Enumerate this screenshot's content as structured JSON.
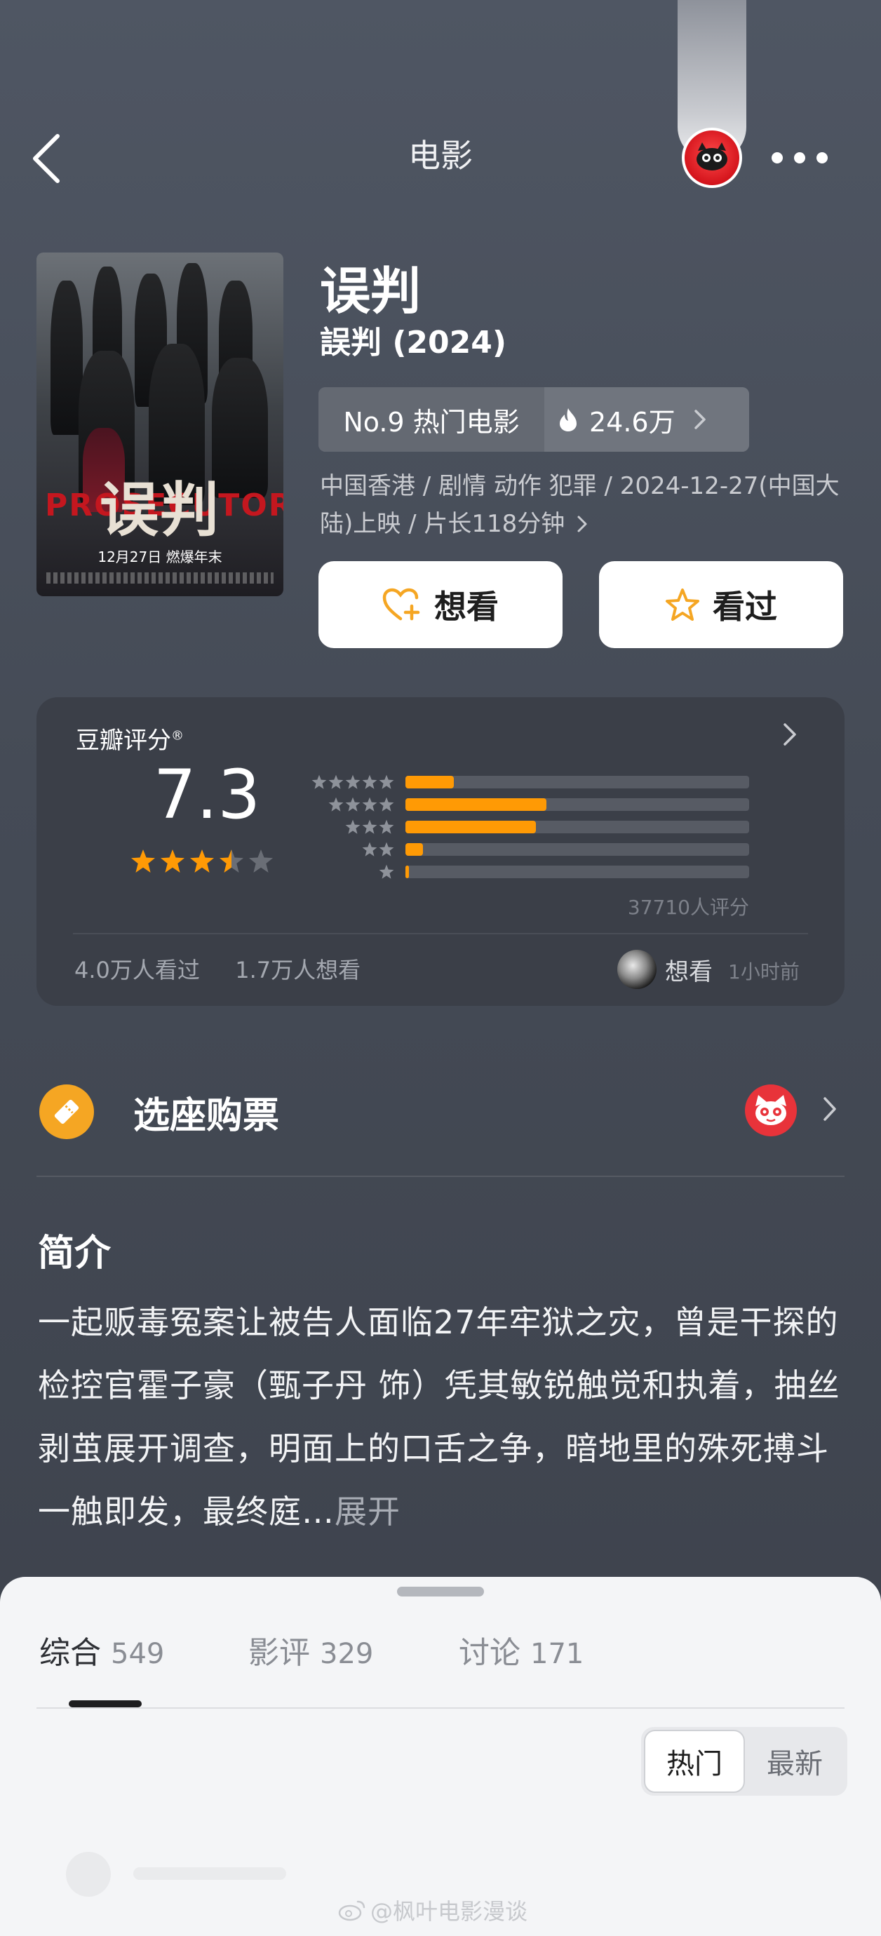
{
  "nav": {
    "title": "电影",
    "back_icon": "chevron-left-icon",
    "more_icon": "more-dots-icon"
  },
  "movie": {
    "title": "误判",
    "original_title": "誤判 (2024)",
    "rank_label": "No.9 热门电影",
    "heat_value": "24.6万",
    "meta": "中国香港 / 剧情 动作 犯罪 / 2024-12-27(中国大陆)上映 / 片长118分钟",
    "poster": {
      "title": "误判",
      "english": "PROSECUTOR",
      "date": "12月27日 燃爆年末"
    }
  },
  "actions": {
    "want_label": "想看",
    "seen_label": "看过"
  },
  "rating": {
    "source_label": "豆瓣评分",
    "score": "7.3",
    "stars": 3.5,
    "distribution": [
      {
        "stars": 5,
        "fraction": 0.14
      },
      {
        "stars": 4,
        "fraction": 0.41
      },
      {
        "stars": 3,
        "fraction": 0.38
      },
      {
        "stars": 2,
        "fraction": 0.05
      },
      {
        "stars": 1,
        "fraction": 0.01
      }
    ],
    "count_label": "37710人评分",
    "watched_label": "4.0万人看过",
    "wish_label": "1.7万人想看",
    "friend_action": "想看",
    "friend_time": "1小时前"
  },
  "tickets": {
    "label": "选座购票"
  },
  "synopsis": {
    "heading": "简介",
    "text": "一起贩毒冤案让被告人面临27年牢狱之灾，曾是干探的检控官霍子豪（甄子丹 饰）凭其敏锐触觉和执着，抽丝剥茧展开调查，明面上的口舌之争，暗地里的殊死搏斗一触即发，最终庭…",
    "more": "展开"
  },
  "sheet": {
    "tabs": [
      {
        "label": "综合",
        "count": "549"
      },
      {
        "label": "影评",
        "count": "329"
      },
      {
        "label": "讨论",
        "count": "171"
      }
    ],
    "sort_hot": "热门",
    "sort_new": "最新"
  },
  "watermark": "@枫叶电影漫谈",
  "colors": {
    "accent_orange": "#ff9a05",
    "ticket_orange": "#f5a623",
    "maoyan_red": "#e8333a",
    "background": "#4a505b"
  }
}
